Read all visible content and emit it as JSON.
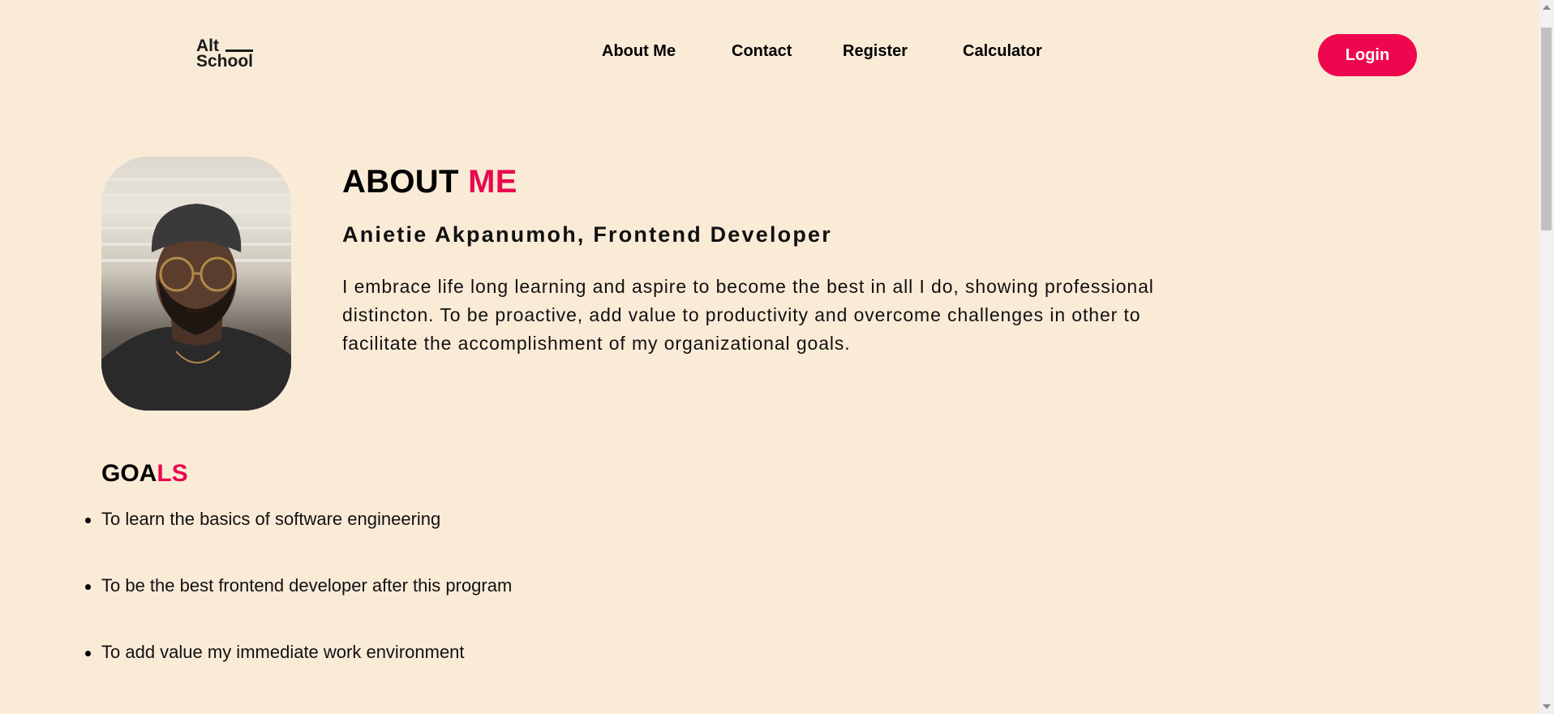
{
  "header": {
    "logo": {
      "line1": "Alt",
      "line2": "School"
    },
    "nav": [
      "About Me",
      "Contact",
      "Register",
      "Calculator"
    ],
    "login_label": "Login"
  },
  "about": {
    "title_main": "ABOUT ",
    "title_accent": "ME",
    "subtitle": "Anietie Akpanumoh, Frontend Developer",
    "bio": "I embrace life long learning and aspire to become the best in all I do, showing professional distincton. To be proactive, add value to productivity and overcome challenges in other to facilitate the accomplishment of my organizational goals."
  },
  "goals": {
    "title_main": "GOA",
    "title_accent": "LS",
    "items": [
      "To learn the basics of software engineering",
      "To be the best frontend developer after this program",
      "To add value my immediate work environment"
    ]
  },
  "colors": {
    "background": "#faebd7",
    "accent": "#e8094e",
    "button": "#f0064e"
  }
}
